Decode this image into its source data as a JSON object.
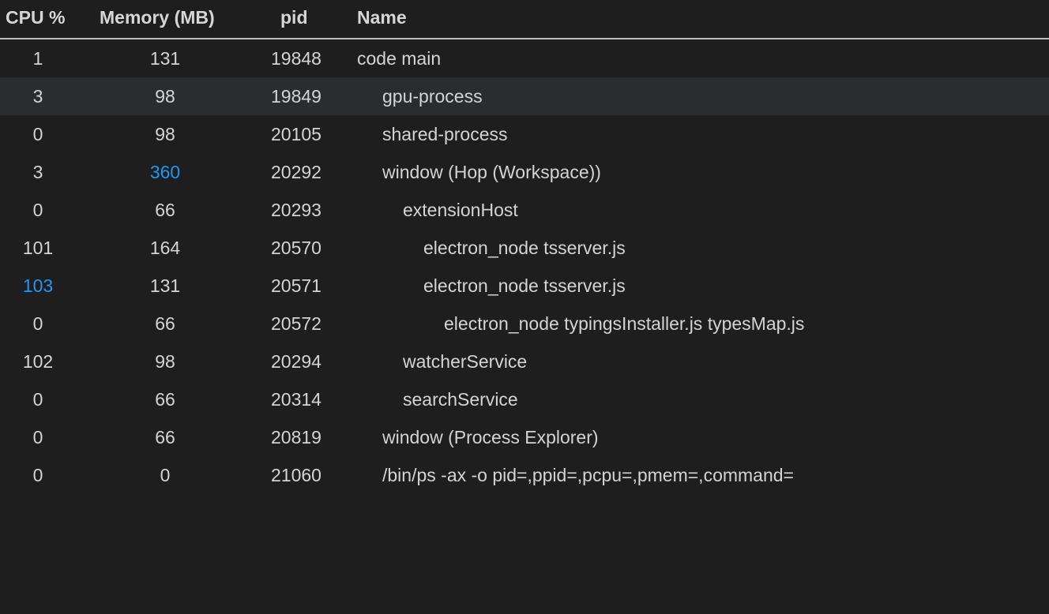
{
  "columns": {
    "cpu": "CPU %",
    "memory": "Memory (MB)",
    "pid": "pid",
    "name": "Name"
  },
  "colors": {
    "background": "#1e1e1e",
    "text": "#d4d4d4",
    "highlight": "#2196f3",
    "selected_row": "#2a2d2e"
  },
  "rows": [
    {
      "cpu": "1",
      "memory": "131",
      "pid": "19848",
      "name": "code main",
      "depth": 0
    },
    {
      "cpu": "3",
      "memory": "98",
      "pid": "19849",
      "name": "gpu-process",
      "depth": 1,
      "selected": true
    },
    {
      "cpu": "0",
      "memory": "98",
      "pid": "20105",
      "name": "shared-process",
      "depth": 1
    },
    {
      "cpu": "3",
      "memory": "360",
      "pid": "20292",
      "name": "window (Hop (Workspace))",
      "depth": 1,
      "memory_highlight": true
    },
    {
      "cpu": "0",
      "memory": "66",
      "pid": "20293",
      "name": "extensionHost",
      "depth": 2
    },
    {
      "cpu": "101",
      "memory": "164",
      "pid": "20570",
      "name": "electron_node tsserver.js",
      "depth": 3
    },
    {
      "cpu": "103",
      "memory": "131",
      "pid": "20571",
      "name": "electron_node tsserver.js",
      "depth": 3,
      "cpu_highlight": true
    },
    {
      "cpu": "0",
      "memory": "66",
      "pid": "20572",
      "name": "electron_node typingsInstaller.js typesMap.js",
      "depth": 4
    },
    {
      "cpu": "102",
      "memory": "98",
      "pid": "20294",
      "name": "watcherService",
      "depth": 2
    },
    {
      "cpu": "0",
      "memory": "66",
      "pid": "20314",
      "name": "searchService",
      "depth": 2
    },
    {
      "cpu": "0",
      "memory": "66",
      "pid": "20819",
      "name": "window (Process Explorer)",
      "depth": 1
    },
    {
      "cpu": "0",
      "memory": "0",
      "pid": "21060",
      "name": "/bin/ps -ax -o pid=,ppid=,pcpu=,pmem=,command=",
      "depth": 1
    }
  ]
}
